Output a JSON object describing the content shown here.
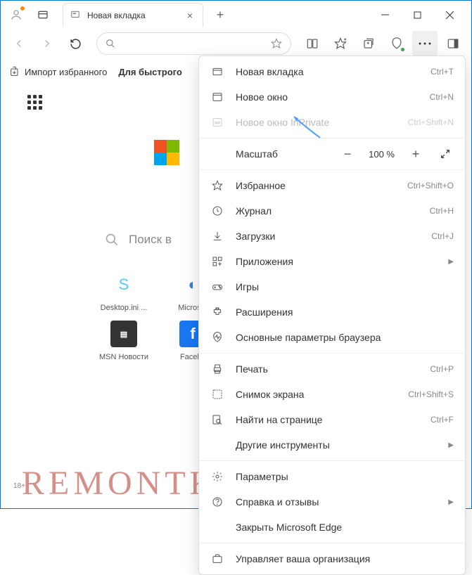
{
  "tab": {
    "title": "Новая вкладка"
  },
  "favbar": {
    "import": "Импорт избранного",
    "quick": "Для быстрого"
  },
  "search": {
    "label": "Поиск в"
  },
  "tiles": [
    {
      "label": "Desktop.ini ..."
    },
    {
      "label": "Micros..."
    },
    {
      "label": "MSN Новости"
    },
    {
      "label": "Facel..."
    }
  ],
  "menu": {
    "newtab": {
      "label": "Новая вкладка",
      "short": "Ctrl+T"
    },
    "newwin": {
      "label": "Новое окно",
      "short": "Ctrl+N"
    },
    "inprivate": {
      "label": "Новое окно InPrivate",
      "short": "Ctrl+Shift+N"
    },
    "zoom": {
      "label": "Масштаб",
      "value": "100 %"
    },
    "favorites": {
      "label": "Избранное",
      "short": "Ctrl+Shift+O"
    },
    "history": {
      "label": "Журнал",
      "short": "Ctrl+H"
    },
    "downloads": {
      "label": "Загрузки",
      "short": "Ctrl+J"
    },
    "apps": {
      "label": "Приложения"
    },
    "games": {
      "label": "Игры"
    },
    "extensions": {
      "label": "Расширения"
    },
    "essentials": {
      "label": "Основные параметры браузера"
    },
    "print": {
      "label": "Печать",
      "short": "Ctrl+P"
    },
    "screenshot": {
      "label": "Снимок экрана",
      "short": "Ctrl+Shift+S"
    },
    "find": {
      "label": "Найти на странице",
      "short": "Ctrl+F"
    },
    "moretools": {
      "label": "Другие инструменты"
    },
    "settings": {
      "label": "Параметры"
    },
    "help": {
      "label": "Справка и отзывы"
    },
    "close": {
      "label": "Закрыть Microsoft Edge"
    },
    "managed": {
      "label": "Управляет ваша организация"
    }
  },
  "age": "18+",
  "watermark": "REMONTKA.COM"
}
